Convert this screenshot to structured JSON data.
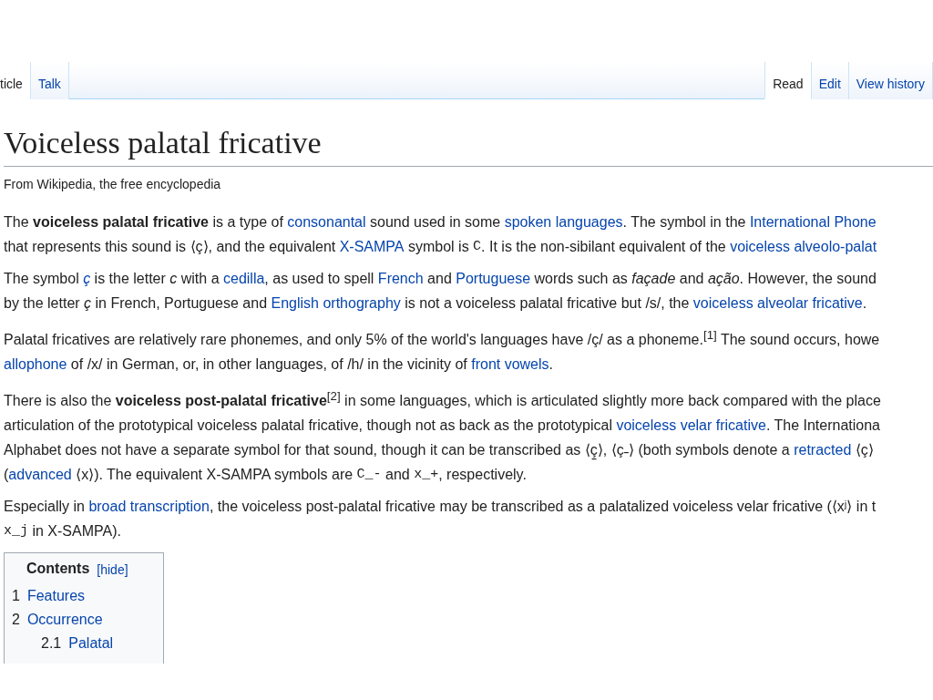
{
  "tabs_left": [
    {
      "label": "ticle",
      "selected": true
    },
    {
      "label": "Talk",
      "selected": false
    }
  ],
  "tabs_right": [
    {
      "label": "Read",
      "selected": true
    },
    {
      "label": "Edit",
      "selected": false
    },
    {
      "label": "View history",
      "selected": false
    }
  ],
  "heading": "Voiceless palatal fricative",
  "tagline": "From Wikipedia, the free encyclopedia",
  "paragraphs": [
    {
      "lines": [
        [
          {
            "kind": "text",
            "text": "The **voiceless palatal fricative** is a type of "
          },
          {
            "kind": "link",
            "text": "consonantal"
          },
          {
            "kind": "text",
            "text": " sound used in some "
          },
          {
            "kind": "link",
            "text": "spoken languages"
          },
          {
            "kind": "text",
            "text": ". The symbol in the "
          },
          {
            "kind": "link",
            "text": "International Phone"
          }
        ],
        [
          {
            "kind": "text",
            "text": "that represents this sound is ⟨ç⟩, and the equivalent "
          },
          {
            "kind": "link",
            "text": "X-SAMPA"
          },
          {
            "kind": "text",
            "text": " symbol is "
          },
          {
            "kind": "code",
            "text": "C"
          },
          {
            "kind": "text",
            "text": ". It is the non-sibilant equivalent of the "
          },
          {
            "kind": "link",
            "text": "voiceless alveolo-palat"
          }
        ]
      ]
    },
    {
      "lines": [
        [
          {
            "kind": "text",
            "text": "The symbol "
          },
          {
            "kind": "link",
            "text": "*ç*"
          },
          {
            "kind": "text",
            "text": " is the letter *c* with a "
          },
          {
            "kind": "link",
            "text": "cedilla"
          },
          {
            "kind": "text",
            "text": ", as used to spell "
          },
          {
            "kind": "link",
            "text": "French"
          },
          {
            "kind": "text",
            "text": " and "
          },
          {
            "kind": "link",
            "text": "Portuguese"
          },
          {
            "kind": "text",
            "text": " words such as *façade* and *ação*. However, the sound"
          }
        ],
        [
          {
            "kind": "text",
            "text": "by the letter *ç* in French, Portuguese and "
          },
          {
            "kind": "link",
            "text": "English orthography"
          },
          {
            "kind": "text",
            "text": " is not a voiceless palatal fricative but /s/, the "
          },
          {
            "kind": "link",
            "text": "voiceless alveolar fricative"
          },
          {
            "kind": "text",
            "text": "."
          }
        ]
      ]
    },
    {
      "lines": [
        [
          {
            "kind": "text",
            "text": "Palatal fricatives are relatively rare phonemes, and only 5% of the world's languages have /ç/ as a phoneme.$^{[1]}$ The sound occurs, howe"
          }
        ],
        [
          {
            "kind": "link",
            "text": "allophone"
          },
          {
            "kind": "text",
            "text": " of /x/ in German, or, in other languages, of /h/ in the vicinity of "
          },
          {
            "kind": "link",
            "text": "front vowels"
          },
          {
            "kind": "text",
            "text": "."
          }
        ]
      ]
    },
    {
      "lines": [
        [
          {
            "kind": "text",
            "text": "There is also the **voiceless post-palatal fricative**$^{[2]}$ in some languages, which is articulated slightly more back compared with the place"
          }
        ],
        [
          {
            "kind": "text",
            "text": "articulation of the prototypical voiceless palatal fricative, though not as back as the prototypical "
          },
          {
            "kind": "link",
            "text": "voiceless velar fricative"
          },
          {
            "kind": "text",
            "text": ". The Internationa"
          }
        ],
        [
          {
            "kind": "text",
            "text": "Alphabet does not have a separate symbol for that sound, though it can be transcribed as ⟨ç̠⟩, ⟨ç˗⟩ (both symbols denote a "
          },
          {
            "kind": "link",
            "text": "retracted"
          },
          {
            "kind": "text",
            "text": " ⟨ç⟩"
          }
        ],
        [
          {
            "kind": "text",
            "text": "("
          },
          {
            "kind": "link",
            "text": "advanced"
          },
          {
            "kind": "text",
            "text": " ⟨x⟩). The equivalent X-SAMPA symbols are "
          },
          {
            "kind": "code",
            "text": "C_-"
          },
          {
            "kind": "text",
            "text": " and "
          },
          {
            "kind": "code",
            "text": "x_+"
          },
          {
            "kind": "text",
            "text": ", respectively."
          }
        ]
      ]
    },
    {
      "lines": [
        [
          {
            "kind": "text",
            "text": "Especially in "
          },
          {
            "kind": "link",
            "text": "broad transcription"
          },
          {
            "kind": "text",
            "text": ", the voiceless post-palatal fricative may be transcribed as a palatalized voiceless velar fricative (⟨xʲ⟩ in t"
          }
        ],
        [
          {
            "kind": "code",
            "text": "x_j"
          },
          {
            "kind": "text",
            "text": " in X-SAMPA)."
          }
        ]
      ]
    }
  ],
  "toc": {
    "title": "Contents",
    "toggle": "[hide]",
    "items": [
      {
        "number": "1",
        "label": "Features"
      },
      {
        "number": "2",
        "label": "Occurrence",
        "children": [
          {
            "number": "2.1",
            "label": "Palatal"
          }
        ]
      }
    ]
  }
}
